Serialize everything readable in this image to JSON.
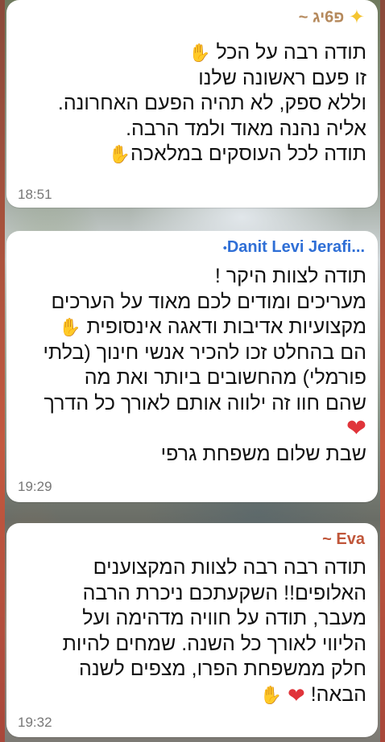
{
  "messages": [
    {
      "sender": "~ פ6יג",
      "sender_color": "#b5895c",
      "lines": [
        "תודה רבה על הכל",
        "זו פעם ראשונה שלנו",
        "וללא ספק, לא תהיה הפעם האחרונה.",
        "אליה נהנה מאוד ולמד הרבה.",
        "תודה לכל העוסקים במלאכה"
      ],
      "time": "18:51"
    },
    {
      "sender": "Danit Levi Jerafi...",
      "sender_color": "#2f6fd6",
      "lines": [
        "תודה לצוות היקר !",
        "מעריכים ומודים לכם מאוד על הערכים",
        "מקצועיות אדיבות ודאגה אינסופית",
        "הם בהחלט זכו להכיר אנשי חינוך (בלתי",
        "פורמלי) מהחשובים ביותר ואת מה",
        "שהם חוו זה ילווה אותם לאורך כל הדרך",
        "",
        "שבת שלום משפחת גרפי"
      ],
      "time": "19:29"
    },
    {
      "sender": "~ Eva",
      "sender_color": "#c0563a",
      "lines": [
        "תודה רבה רבה לצוות המקצוענים",
        "האלופים!! השקעתכם ניכרת הרבה",
        "מעבר, תודה על חוויה מדהימה ועל",
        "הליווי לאורך כל השנה. שמחים להיות",
        "חלק ממשפחת הפרו, מצפים לשנה",
        "הבאה!"
      ],
      "time": "19:32"
    }
  ],
  "icons": {
    "sparkle": "✨",
    "pray": "🙏",
    "heart": "❤"
  }
}
